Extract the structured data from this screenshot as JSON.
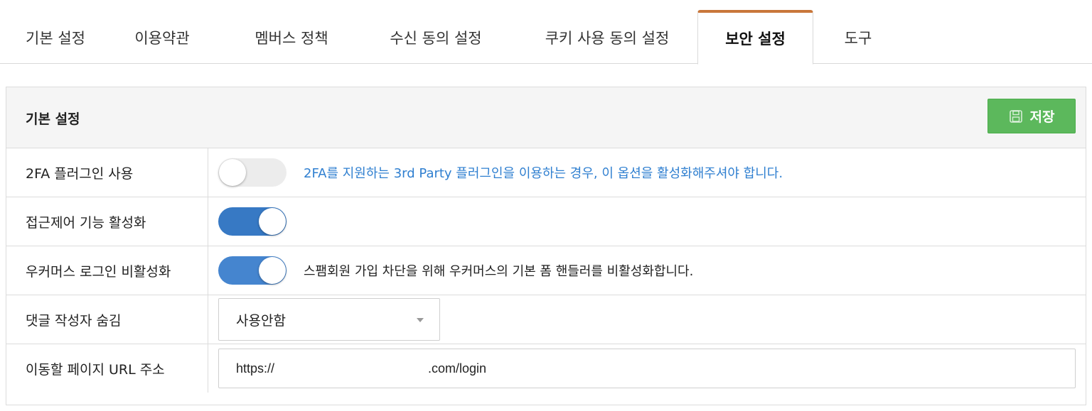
{
  "tabs": [
    {
      "label": "기본 설정",
      "active": false
    },
    {
      "label": "이용약관",
      "active": false
    },
    {
      "label": "멤버스 정책",
      "active": false
    },
    {
      "label": "수신 동의 설정",
      "active": false
    },
    {
      "label": "쿠키 사용 동의 설정",
      "active": false
    },
    {
      "label": "보안 설정",
      "active": true
    },
    {
      "label": "도구",
      "active": false
    }
  ],
  "panel": {
    "title": "기본 설정",
    "save_label": "저장",
    "save_icon": "floppy-disk-icon"
  },
  "rows": {
    "twofa": {
      "label": "2FA 플러그인 사용",
      "enabled": false,
      "description": "2FA를 지원하는 3rd Party 플러그인을 이용하는 경우, 이 옵션을 활성화해주셔야 합니다."
    },
    "access_control": {
      "label": "접근제어 기능 활성화",
      "enabled": true
    },
    "woo_login": {
      "label": "우커머스 로그인 비활성화",
      "enabled": true,
      "description": "스팸회원 가입 차단을 위해 우커머스의 기본 폼 핸들러를 비활성화합니다."
    },
    "hide_author": {
      "label": "댓글 작성자 숨김",
      "selected": "사용안함"
    },
    "redirect_url": {
      "label": "이동할 페이지 URL 주소",
      "value_prefix": "https://",
      "value_suffix": ".com/login"
    }
  },
  "colors": {
    "active_tab_accent": "#c9773a",
    "save_button": "#5cb85c",
    "toggle_on": "#3779c4",
    "link_text": "#2f7fd0"
  }
}
